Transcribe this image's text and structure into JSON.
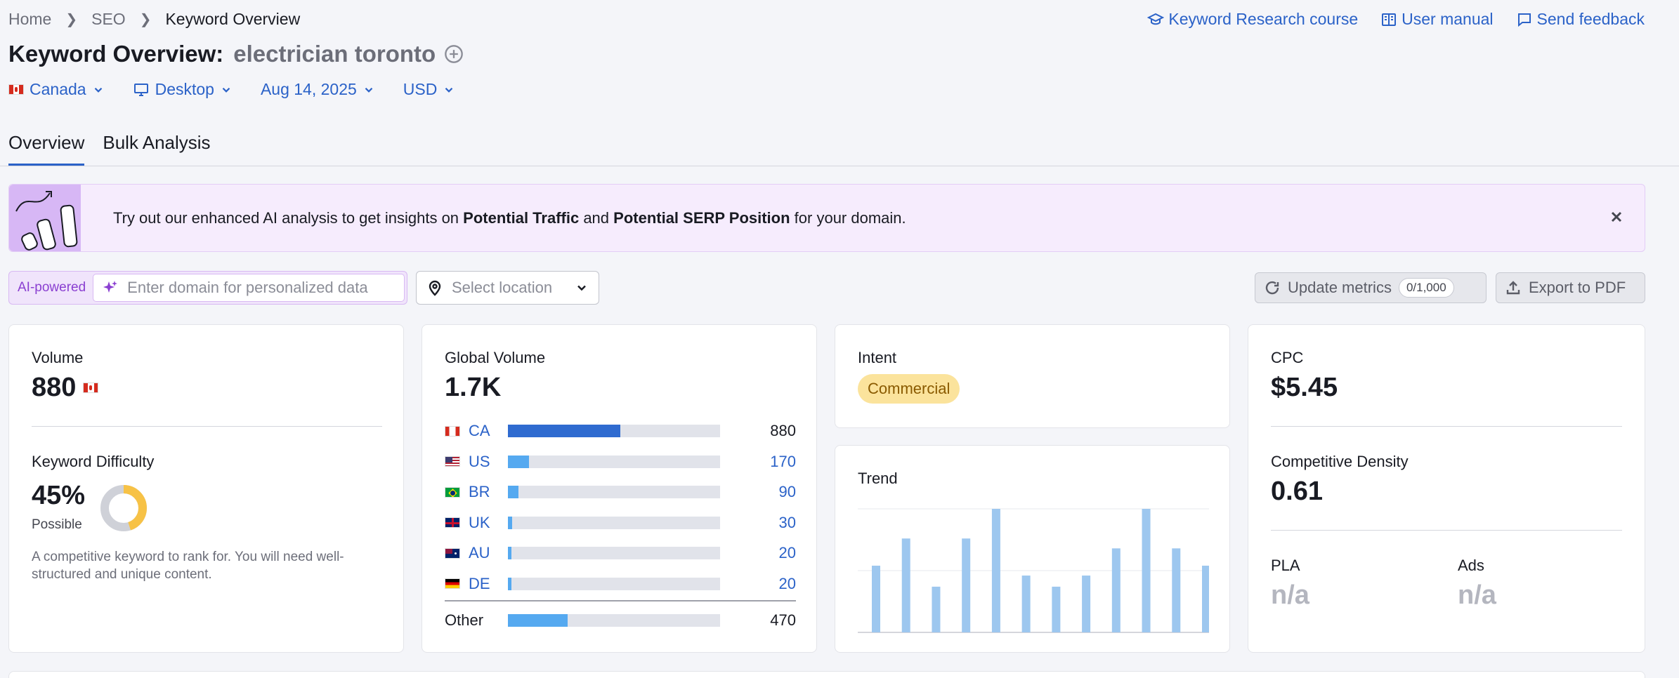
{
  "breadcrumb": [
    "Home",
    "SEO",
    "Keyword Overview"
  ],
  "top_links": [
    {
      "label": "Keyword Research course",
      "icon": "graduation-cap-icon"
    },
    {
      "label": "User manual",
      "icon": "book-icon"
    },
    {
      "label": "Send feedback",
      "icon": "message-icon"
    }
  ],
  "title": {
    "prefix": "Keyword Overview:",
    "keyword": "electrician toronto"
  },
  "filters": {
    "country": "Canada",
    "device": "Desktop",
    "date": "Aug 14, 2025",
    "currency": "USD"
  },
  "tabs": [
    {
      "label": "Overview",
      "active": true
    },
    {
      "label": "Bulk Analysis",
      "active": false
    }
  ],
  "banner": {
    "text_1": "Try out our enhanced AI analysis to get insights on ",
    "bold_1": "Potential Traffic",
    "text_2": " and ",
    "bold_2": "Potential SERP Position",
    "text_3": " for your domain."
  },
  "ai": {
    "label": "AI-powered",
    "placeholder": "Enter domain for personalized data"
  },
  "location": {
    "placeholder": "Select location"
  },
  "update": {
    "label": "Update metrics",
    "count": "0/1,000"
  },
  "export": {
    "label": "Export to PDF"
  },
  "volume": {
    "label": "Volume",
    "value": "880"
  },
  "difficulty": {
    "label": "Keyword Difficulty",
    "value": "45%",
    "level": "Possible",
    "percent": 45,
    "description": "A competitive keyword to rank for. You will need well-structured and unique content."
  },
  "global_volume": {
    "label": "Global Volume",
    "value": "1.7K",
    "rows": [
      {
        "code": "CA",
        "value": "880",
        "fraction": 0.53,
        "flag": "ca"
      },
      {
        "code": "US",
        "value": "170",
        "fraction": 0.1,
        "flag": "us"
      },
      {
        "code": "BR",
        "value": "90",
        "fraction": 0.05,
        "flag": "br"
      },
      {
        "code": "UK",
        "value": "30",
        "fraction": 0.02,
        "flag": "uk"
      },
      {
        "code": "AU",
        "value": "20",
        "fraction": 0.015,
        "flag": "au"
      },
      {
        "code": "DE",
        "value": "20",
        "fraction": 0.015,
        "flag": "de"
      }
    ],
    "other": {
      "label": "Other",
      "value": "470",
      "fraction": 0.28
    }
  },
  "intent": {
    "label": "Intent",
    "value": "Commercial"
  },
  "trend": {
    "label": "Trend",
    "values": [
      0.54,
      0.76,
      0.37,
      0.76,
      1.0,
      0.46,
      0.37,
      0.46,
      0.68,
      1.0,
      0.68,
      0.54
    ]
  },
  "cpc": {
    "label": "CPC",
    "value": "$5.45"
  },
  "competitive_density": {
    "label": "Competitive Density",
    "value": "0.61"
  },
  "pla": {
    "label": "PLA",
    "value": "n/a"
  },
  "ads": {
    "label": "Ads",
    "value": "n/a"
  },
  "colors": {
    "accent": "#2b62c8",
    "bar_dark": "#2f6bd0",
    "bar_light": "#55a9f0",
    "trend_bar": "#9dc7ef",
    "difficulty": "#f7c246"
  }
}
